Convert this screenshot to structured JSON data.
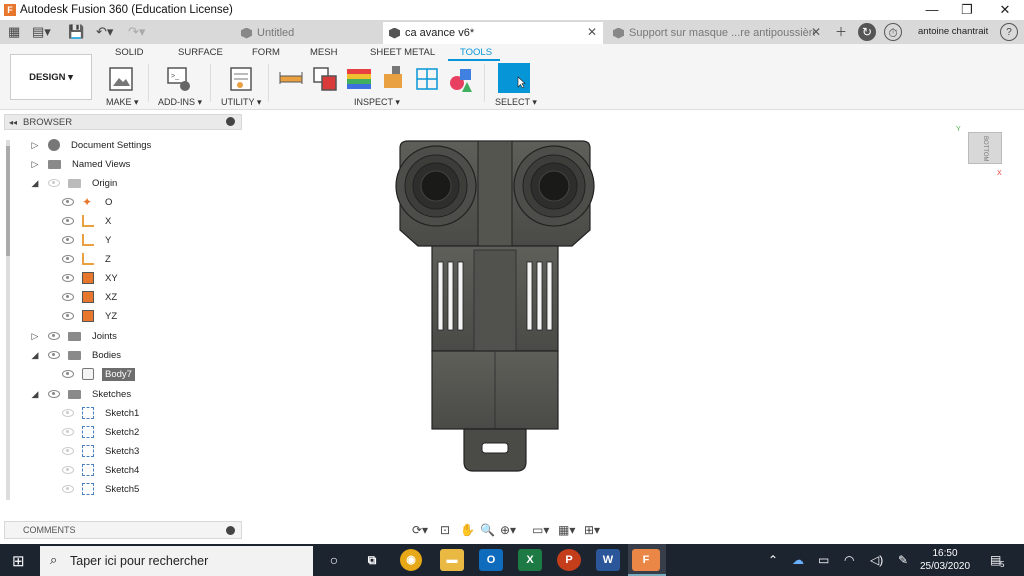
{
  "window": {
    "title": "Autodesk Fusion 360 (Education License)",
    "min": "—",
    "max": "❐",
    "close": "✕"
  },
  "tabs": [
    {
      "label": "Untitled"
    },
    {
      "label": "ca avance v6*"
    },
    {
      "label": "Support sur masque ...re antipoussière v1"
    }
  ],
  "user": {
    "name": "antoine chantrait"
  },
  "ribbon": {
    "tabs": [
      "SOLID",
      "SURFACE",
      "FORM",
      "MESH",
      "SHEET METAL",
      "TOOLS"
    ],
    "design": "DESIGN ▾",
    "groups": [
      "MAKE ▾",
      "ADD-INS ▾",
      "UTILITY ▾",
      "INSPECT ▾",
      "SELECT ▾"
    ]
  },
  "browser": {
    "header": "BROWSER",
    "items": [
      {
        "label": "Document Settings"
      },
      {
        "label": "Named Views"
      },
      {
        "label": "Origin"
      },
      {
        "label": "O"
      },
      {
        "label": "X"
      },
      {
        "label": "Y"
      },
      {
        "label": "Z"
      },
      {
        "label": "XY"
      },
      {
        "label": "XZ"
      },
      {
        "label": "YZ"
      },
      {
        "label": "Joints"
      },
      {
        "label": "Bodies"
      },
      {
        "label": "Body7"
      },
      {
        "label": "Sketches"
      },
      {
        "label": "Sketch1"
      },
      {
        "label": "Sketch2"
      },
      {
        "label": "Sketch3"
      },
      {
        "label": "Sketch4"
      },
      {
        "label": "Sketch5"
      }
    ]
  },
  "comments": {
    "label": "COMMENTS"
  },
  "viewcube": {
    "face": "BOTTOM",
    "axis_y": "Y",
    "axis_x": "X"
  },
  "taskbar": {
    "search_placeholder": "Taper ici pour rechercher",
    "time": "16:50",
    "date": "25/03/2020",
    "notif": "5"
  }
}
